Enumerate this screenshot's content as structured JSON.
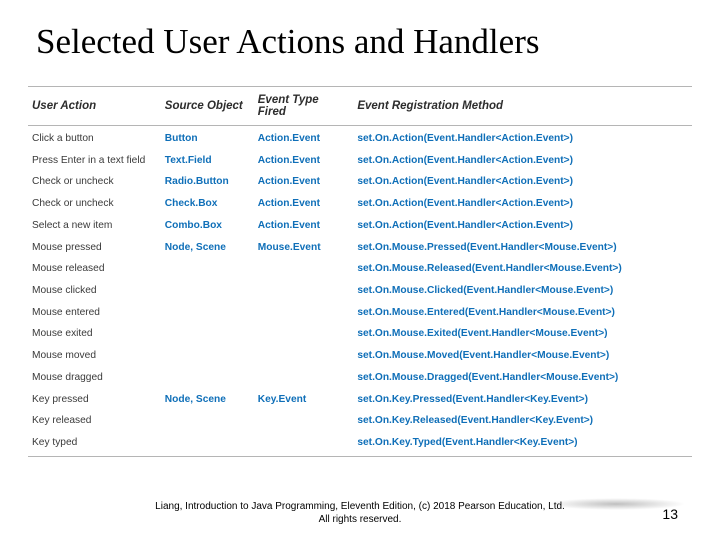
{
  "title": "Selected User Actions and Handlers",
  "headers": {
    "c1": "User Action",
    "c2": "Source Object",
    "c3": "Event Type Fired",
    "c4": "Event Registration Method"
  },
  "rows": [
    {
      "action": "Click a button",
      "source": "Button",
      "event": "Action.Event",
      "method": "set.On.Action(Event.Handler<Action.Event>)"
    },
    {
      "action": "Press Enter in a text field",
      "source": "Text.Field",
      "event": "Action.Event",
      "method": "set.On.Action(Event.Handler<Action.Event>)"
    },
    {
      "action": "Check or uncheck",
      "source": "Radio.Button",
      "event": "Action.Event",
      "method": "set.On.Action(Event.Handler<Action.Event>)"
    },
    {
      "action": "Check or uncheck",
      "source": "Check.Box",
      "event": "Action.Event",
      "method": "set.On.Action(Event.Handler<Action.Event>)"
    },
    {
      "action": "Select a new item",
      "source": "Combo.Box",
      "event": "Action.Event",
      "method": "set.On.Action(Event.Handler<Action.Event>)"
    },
    {
      "action": "Mouse pressed",
      "source": "Node, Scene",
      "event": "Mouse.Event",
      "method": "set.On.Mouse.Pressed(Event.Handler<Mouse.Event>)"
    },
    {
      "action": "Mouse released",
      "source": "",
      "event": "",
      "method": "set.On.Mouse.Released(Event.Handler<Mouse.Event>)"
    },
    {
      "action": "Mouse clicked",
      "source": "",
      "event": "",
      "method": "set.On.Mouse.Clicked(Event.Handler<Mouse.Event>)"
    },
    {
      "action": "Mouse entered",
      "source": "",
      "event": "",
      "method": "set.On.Mouse.Entered(Event.Handler<Mouse.Event>)"
    },
    {
      "action": "Mouse exited",
      "source": "",
      "event": "",
      "method": "set.On.Mouse.Exited(Event.Handler<Mouse.Event>)"
    },
    {
      "action": "Mouse moved",
      "source": "",
      "event": "",
      "method": "set.On.Mouse.Moved(Event.Handler<Mouse.Event>)"
    },
    {
      "action": "Mouse dragged",
      "source": "",
      "event": "",
      "method": "set.On.Mouse.Dragged(Event.Handler<Mouse.Event>)"
    },
    {
      "action": "Key pressed",
      "source": "Node, Scene",
      "event": "Key.Event",
      "method": "set.On.Key.Pressed(Event.Handler<Key.Event>)"
    },
    {
      "action": "Key released",
      "source": "",
      "event": "",
      "method": "set.On.Key.Released(Event.Handler<Key.Event>)"
    },
    {
      "action": "Key typed",
      "source": "",
      "event": "",
      "method": "set.On.Key.Typed(Event.Handler<Key.Event>)"
    }
  ],
  "footer": {
    "line1": "Liang, Introduction to Java Programming, Eleventh Edition, (c) 2018 Pearson Education, Ltd.",
    "line2": "All rights reserved."
  },
  "page_number": "13"
}
